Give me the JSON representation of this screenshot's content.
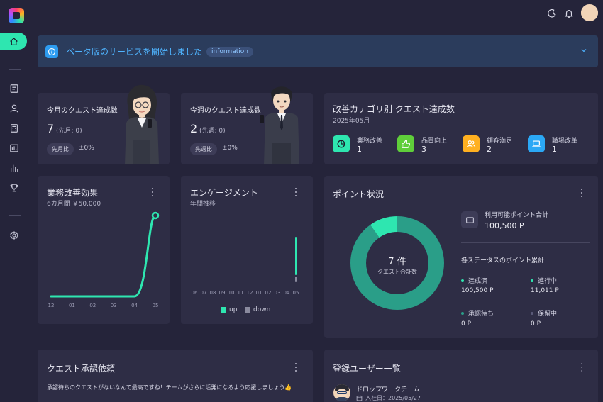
{
  "banner": {
    "title": "ベータ版のサービスを開始しました",
    "chip": "information"
  },
  "monthly_card": {
    "title": "今月のクエスト達成数",
    "count": "7",
    "previous": "(先月: 0)",
    "pill": "先月比",
    "change": "±0%"
  },
  "weekly_card": {
    "title": "今週のクエスト達成数",
    "count": "2",
    "previous": "(先週: 0)",
    "pill": "先週比",
    "change": "±0%"
  },
  "category_card": {
    "title": "改善カテゴリ別 クエスト達成数",
    "subtitle": "2025年05月",
    "items": [
      {
        "label": "業務改善",
        "value": "1",
        "color": "#2ee6b0",
        "icon": "pie-chart-icon"
      },
      {
        "label": "品質向上",
        "value": "3",
        "color": "#5fce3a",
        "icon": "thumbs-up-icon"
      },
      {
        "label": "顧客満足",
        "value": "2",
        "color": "#ffb020",
        "icon": "users-icon"
      },
      {
        "label": "職場改革",
        "value": "1",
        "color": "#2ba8f5",
        "icon": "laptop-icon"
      }
    ]
  },
  "effect_card": {
    "title": "業務改善効果",
    "subtitle": "6カ月間 ￥50,000"
  },
  "engagement_card": {
    "title": "エンゲージメント",
    "subtitle": "年間推移",
    "legend_up": "up",
    "legend_down": "down"
  },
  "points_card": {
    "title": "ポイント状況",
    "center_value": "7 件",
    "center_label": "クエスト合計数",
    "available_label": "利用可能ポイント合計",
    "available_value": "100,500 P",
    "status_title": "各ステータスのポイント累計",
    "statuses": [
      {
        "label": "達成済",
        "value": "100,500 P",
        "color": "#2ee6b0"
      },
      {
        "label": "進行中",
        "value": "11,011 P",
        "color": "#2ee6b0"
      },
      {
        "label": "承認待ち",
        "value": "0 P",
        "color": "#2a9e88"
      },
      {
        "label": "保留中",
        "value": "0 P",
        "color": "#5a5a78"
      }
    ]
  },
  "approval_card": {
    "title": "クエスト承認依頼",
    "message": "承認待ちのクエストがないなんて最高ですね！チームがさらに活発になるよう応援しましょう👍"
  },
  "users_card": {
    "title": "登録ユーザー一覧",
    "user_name": "ドロップワークチーム",
    "user_joined": "入社日：2025/05/27"
  },
  "chart_data": [
    {
      "type": "line",
      "title": "業務改善効果",
      "categories": [
        "12",
        "01",
        "02",
        "03",
        "04",
        "05"
      ],
      "series": [
        {
          "values": [
            0,
            0,
            0,
            0,
            0,
            50000
          ]
        }
      ]
    },
    {
      "type": "bar",
      "title": "エンゲージメント",
      "categories": [
        "06",
        "07",
        "08",
        "09",
        "10",
        "11",
        "12",
        "01",
        "02",
        "03",
        "04",
        "05"
      ],
      "series": [
        {
          "name": "up",
          "values": [
            0,
            0,
            0,
            0,
            0,
            0,
            0,
            0,
            0,
            0,
            0,
            9
          ]
        },
        {
          "name": "down",
          "values": [
            0,
            0,
            0,
            0,
            0,
            0,
            0,
            0,
            0,
            0,
            0,
            1
          ]
        }
      ]
    },
    {
      "type": "pie",
      "title": "ポイント状況",
      "series": [
        {
          "name": "達成済",
          "values": [
            100500
          ]
        },
        {
          "name": "進行中",
          "values": [
            11011
          ]
        }
      ]
    }
  ]
}
